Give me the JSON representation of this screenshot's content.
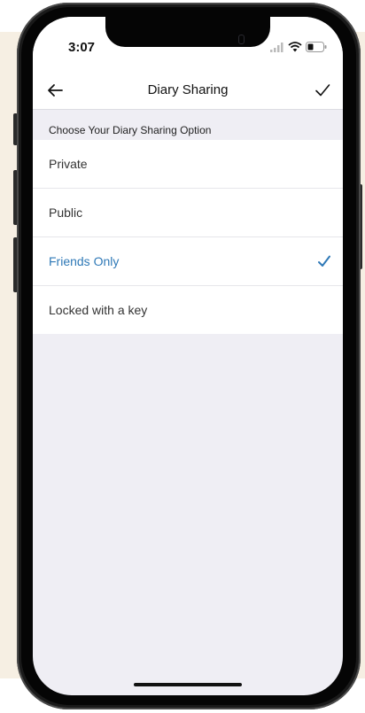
{
  "status_bar": {
    "time": "3:07"
  },
  "nav": {
    "title": "Diary Sharing",
    "back_icon": "arrow-left-icon",
    "done_icon": "checkmark-icon"
  },
  "section": {
    "header": "Choose Your Diary Sharing Option"
  },
  "options": [
    {
      "label": "Private",
      "selected": false
    },
    {
      "label": "Public",
      "selected": false
    },
    {
      "label": "Friends Only",
      "selected": true
    },
    {
      "label": "Locked with a key",
      "selected": false
    }
  ],
  "colors": {
    "accent": "#2f79b7",
    "background": "#efeef4",
    "page_backdrop": "#f6efe3"
  }
}
